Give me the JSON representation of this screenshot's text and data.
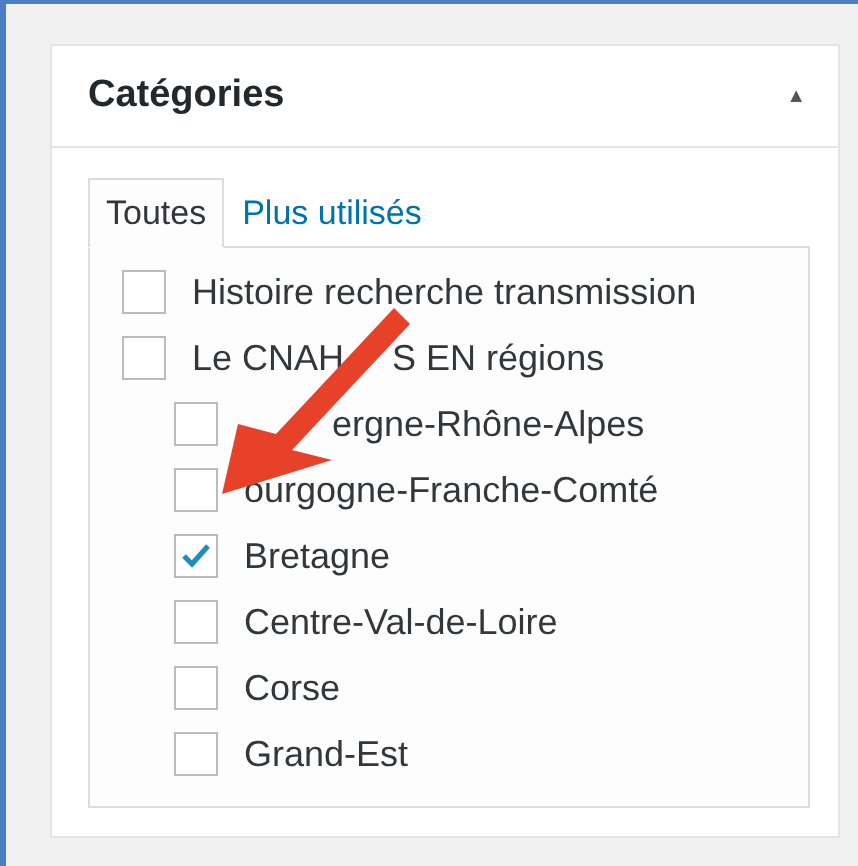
{
  "panel": {
    "title": "Catégories",
    "toggle": "▲"
  },
  "tabs": [
    {
      "label": "Toutes",
      "selected": true
    },
    {
      "label": "Plus utilisés",
      "selected": false
    }
  ],
  "categories": [
    {
      "label": "Histoire recherche transmission",
      "checked": false
    },
    {
      "label_parts": [
        "Le CNAH",
        "S EN régions"
      ],
      "checked": false,
      "children": [
        {
          "label": "ergne-Rhône-Alpes",
          "checked": false,
          "covered": true
        },
        {
          "label": "ourgogne-Franche-Comté",
          "checked": false
        },
        {
          "label": "Bretagne",
          "checked": true
        },
        {
          "label": "Centre-Val-de-Loire",
          "checked": false
        },
        {
          "label": "Corse",
          "checked": false
        },
        {
          "label": "Grand-Est",
          "checked": false
        }
      ]
    }
  ]
}
